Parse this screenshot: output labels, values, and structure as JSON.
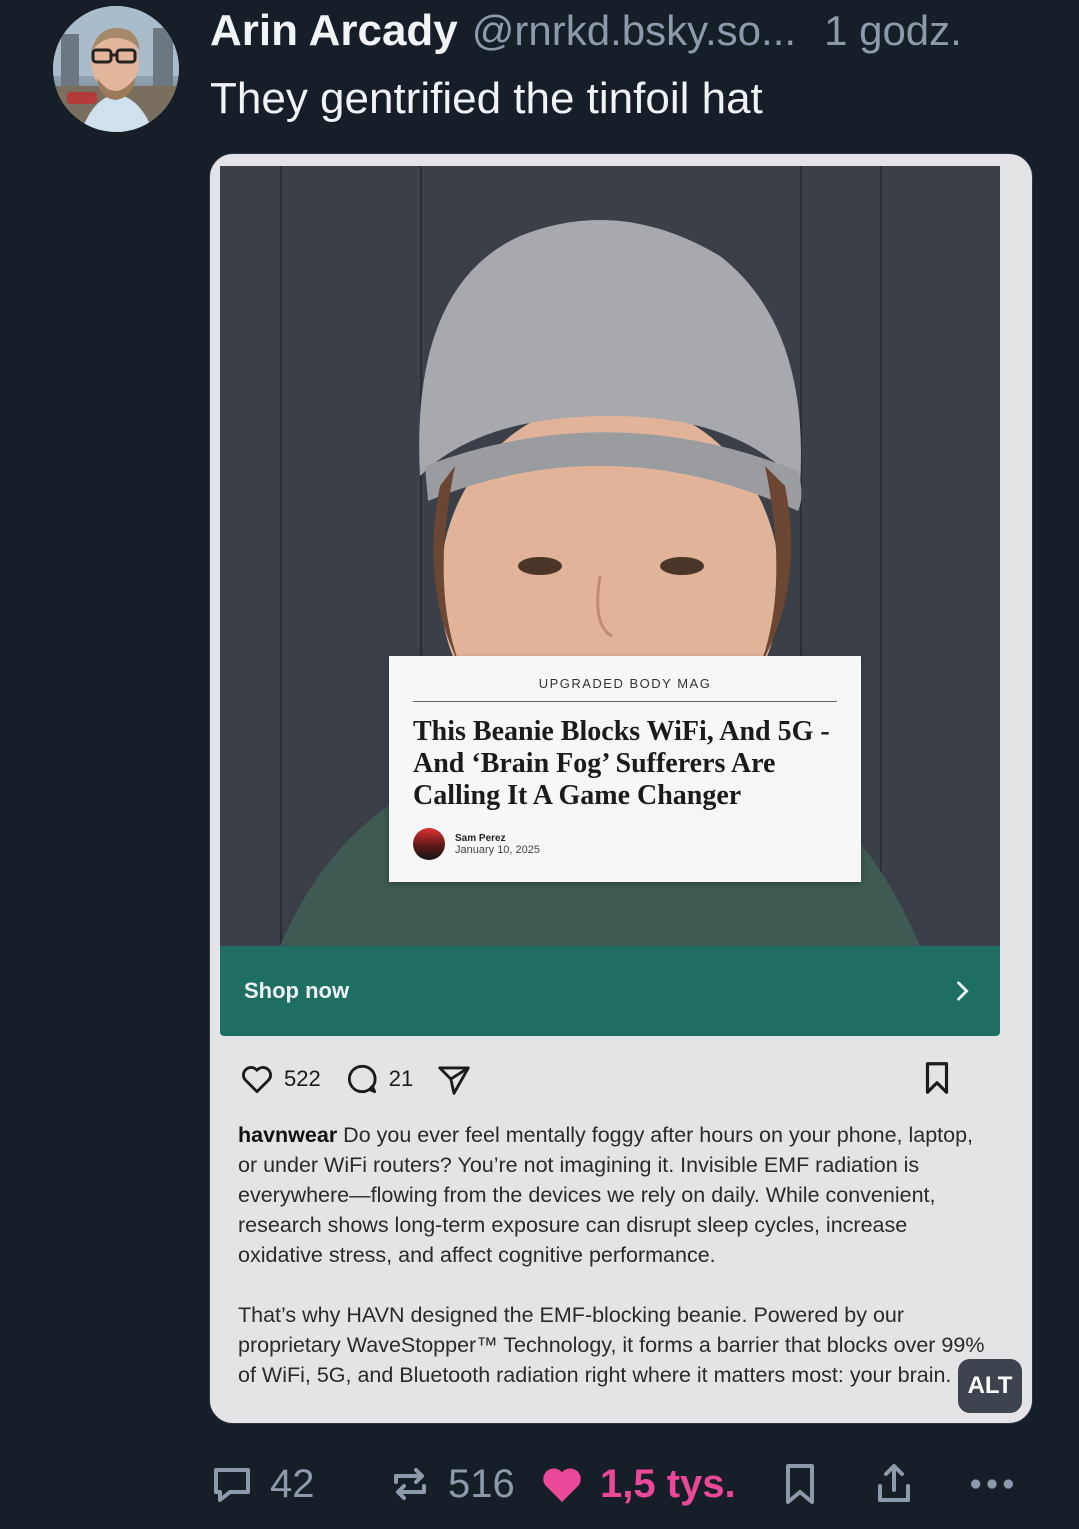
{
  "post": {
    "author": "Arin Arcady",
    "handle": "@rnrkd.bsky.so...",
    "time": "1 godz.",
    "text": "They gentrified the tinfoil hat"
  },
  "embed": {
    "article": {
      "magazine": "UPGRADED BODY MAG",
      "headline": "This Beanie Blocks WiFi, And 5G - And ‘Brain Fog’ Sufferers Are Calling It A Game Changer",
      "author": "Sam Perez",
      "date": "January 10, 2025"
    },
    "shop_label": "Shop now",
    "likes": "522",
    "comments": "21",
    "caption_user": "havnwear",
    "caption_p1": "Do you ever feel mentally foggy after hours on your phone, laptop, or under WiFi routers? You’re not imagining it. Invisible EMF radiation is everywhere—flowing from the devices we rely on daily. While convenient, research shows long-term exposure can disrupt sleep cycles, increase oxidative stress, and affect cognitive performance.",
    "caption_p2": "That’s why HAVN designed the EMF-blocking beanie. Powered by our proprietary WaveStopper™ Technology, it forms a barrier that blocks over 99% of WiFi, 5G, and Bluetooth radiation right where it matters most: your brain.",
    "alt_label": "ALT"
  },
  "footer": {
    "replies": "42",
    "reposts": "516",
    "likes": "1,5 tys."
  },
  "colors": {
    "background": "#161e27",
    "accent_like": "#ec4899",
    "shop_bar": "#1f6e62",
    "muted_text": "#8c9aab"
  },
  "icons": [
    "reply-icon",
    "repost-icon",
    "heart-icon",
    "bookmark-icon",
    "share-icon",
    "more-icon",
    "chevron-right-icon",
    "send-icon"
  ]
}
